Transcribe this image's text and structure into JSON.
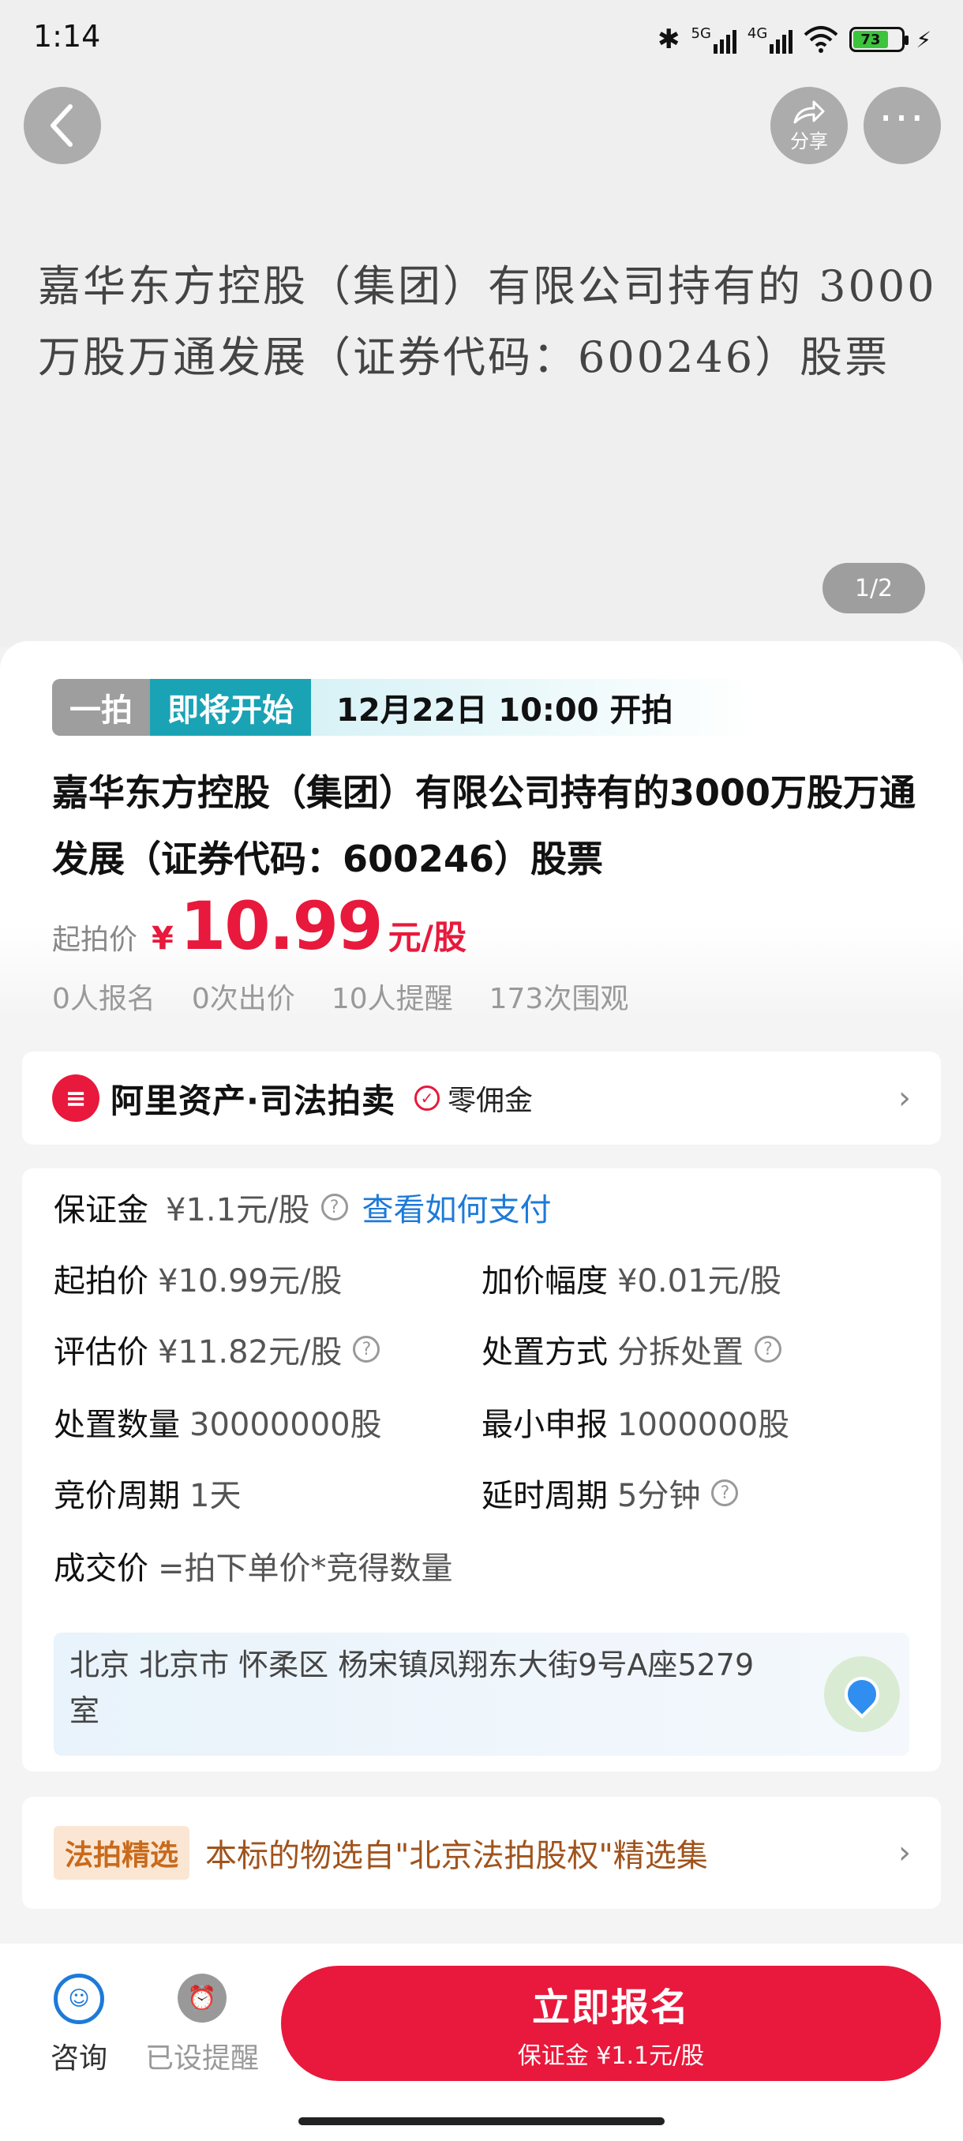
{
  "status_bar": {
    "time": "1:14",
    "network_1": "5G",
    "network_2": "4G",
    "battery": "73"
  },
  "nav": {
    "share_label": "分享",
    "more_label": "···"
  },
  "banner": {
    "text_line1": "嘉华东方控股（集团）有限公司持有的 3000",
    "text_line2": "万股万通发展（证券代码：600246）股票",
    "page_indicator": "1/2"
  },
  "tags": {
    "round": "一拍",
    "status": "即将开始",
    "start_time": "12月22日 10:00 开拍"
  },
  "title": "嘉华东方控股（集团）有限公司持有的3000万股万通发展（证券代码：600246）股票",
  "price": {
    "label": "起拍价",
    "currency": "¥",
    "value": "10.99",
    "unit": "元/股"
  },
  "stats": [
    "0人报名",
    "0次出价",
    "10人提醒",
    "173次围观"
  ],
  "brand": {
    "name": "阿里资产·司法拍卖",
    "zero_fee": "零佣金"
  },
  "details": {
    "deposit_label": "保证金",
    "deposit_value": "¥1.1元/股",
    "deposit_link": "查看如何支付",
    "start_price_label": "起拍价",
    "start_price_value": "¥10.99元/股",
    "increment_label": "加价幅度",
    "increment_value": "¥0.01元/股",
    "appraisal_label": "评估价",
    "appraisal_value": "¥11.82元/股",
    "method_label": "处置方式",
    "method_value": "分拆处置",
    "quantity_label": "处置数量",
    "quantity_value": "30000000股",
    "min_label": "最小申报",
    "min_value": "1000000股",
    "cycle_label": "竞价周期",
    "cycle_value": "1天",
    "delay_label": "延时周期",
    "delay_value": "5分钟",
    "deal_label": "成交价",
    "deal_value": "=拍下单价*竞得数量",
    "address": "北京 北京市 怀柔区 杨宋镇凤翔东大街9号A座5279室"
  },
  "selection": {
    "tag": "法拍精选",
    "text": "本标的物选自\"北京法拍股权\"精选集"
  },
  "bottom": {
    "consult": "咨询",
    "remind": "已设提醒",
    "signup": "立即报名",
    "signup_sub": "保证金 ¥1.1元/股"
  },
  "colors": {
    "accent_red": "#e8193c",
    "status_teal": "#1aa3b5",
    "link_blue": "#1d7ad8"
  }
}
